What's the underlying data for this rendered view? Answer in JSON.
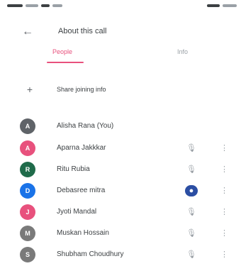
{
  "status_bar": {
    "left_icons": [
      "signal-icon",
      "wifi-icon",
      "notification-icon"
    ],
    "right_icons": [
      "battery-icon"
    ]
  },
  "header": {
    "back_icon": "arrow-back-icon",
    "title": "About this call"
  },
  "tabs": [
    {
      "label": "People",
      "active": true
    },
    {
      "label": "Info",
      "active": false
    }
  ],
  "sections": {
    "add_label": "",
    "people_label": ""
  },
  "add_people": {
    "icon": "person-add-icon",
    "label": "Share joining info"
  },
  "people": [
    {
      "name": "Alisha Rana (You)",
      "avatar_color": "#5f6368",
      "initial": "A",
      "action_icon": "",
      "show_more": false
    },
    {
      "name": "Aparna Jakkkar",
      "avatar_color": "#e8517d",
      "initial": "A",
      "action_icon": "mic-off-icon",
      "show_more": true
    },
    {
      "name": "Ritu Rubia",
      "avatar_color": "#1f6b4a",
      "initial": "R",
      "action_icon": "mic-off-icon",
      "show_more": true
    },
    {
      "name": "Debasree mitra",
      "avatar_color": "#1a73e8",
      "initial": "D",
      "action_icon": "mic-on-icon",
      "active": true,
      "show_more": true
    },
    {
      "name": "Jyoti Mandal",
      "avatar_color": "#e8517d",
      "initial": "J",
      "action_icon": "mic-off-icon",
      "show_more": true
    },
    {
      "name": "Muskan Hossain",
      "avatar_color": "#7a7a7a",
      "initial": "M",
      "action_icon": "mic-off-icon",
      "show_more": true
    },
    {
      "name": "Shubham Choudhury",
      "avatar_color": "#7a7a7a",
      "initial": "S",
      "action_icon": "mic-off-icon",
      "show_more": true
    }
  ],
  "colors": {
    "accent": "#e8517d",
    "text": "#3c4043",
    "muted": "#9aa0a6",
    "active_mic": "#2b4ea3"
  }
}
